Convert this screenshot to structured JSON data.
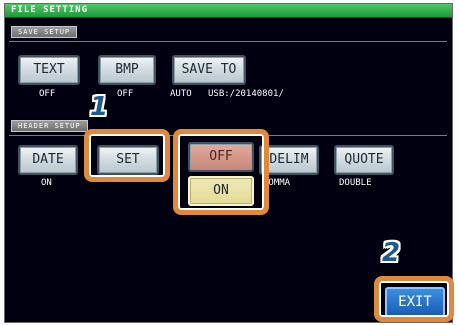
{
  "title": "FILE SETTING",
  "save_setup": {
    "section_label": "SAVE SETUP",
    "text_button": "TEXT",
    "text_value": "OFF",
    "bmp_button": "BMP",
    "bmp_value": "OFF",
    "save_to_button": "SAVE TO",
    "save_to_mode": "AUTO",
    "save_to_path": "USB:/20140801/"
  },
  "header_setup": {
    "section_label": "HEADER SETUP",
    "date_button": "DATE",
    "date_value": "ON",
    "set_button": "SET",
    "off_option": "OFF",
    "on_option": "ON",
    "delim_button": "DELIM",
    "delim_value": "COMMA",
    "quote_button": "QUOTE",
    "quote_value": "DOUBLE"
  },
  "exit_button": "EXIT",
  "step_badges": [
    "1",
    "2"
  ],
  "colors": {
    "highlight_ring": "#e0893a",
    "badge": "#1e5a92",
    "exit": "#2a76cc",
    "title_bar": "#2fb24e"
  }
}
